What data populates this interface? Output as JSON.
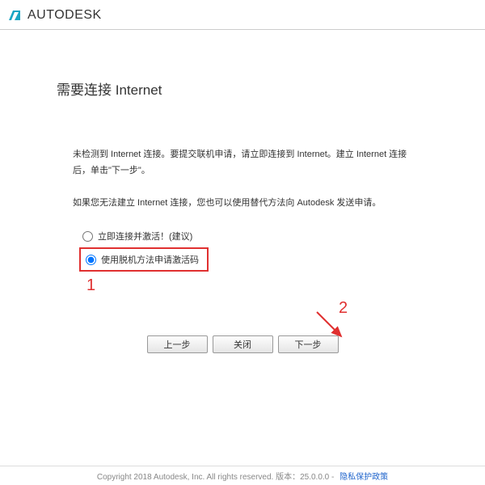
{
  "header": {
    "brand": "AUTODESK"
  },
  "page": {
    "title": "需要连接 Internet"
  },
  "body": {
    "paragraph1": "未检测到 Internet 连接。要提交联机申请，请立即连接到 Internet。建立 Internet 连接后，单击\"下一步\"。",
    "paragraph2": "如果您无法建立 Internet 连接，您也可以使用替代方法向 Autodesk 发送申请。"
  },
  "options": {
    "opt1_label": "立即连接并激活！(建议)",
    "opt2_label": "使用脱机方法申请激活码"
  },
  "annotations": {
    "mark1": "1",
    "mark2": "2"
  },
  "buttons": {
    "back": "上一步",
    "close": "关闭",
    "next": "下一步"
  },
  "footer": {
    "copyright": "Copyright 2018 Autodesk, Inc. All rights reserved.  版本：25.0.0.0 -",
    "privacy": "隐私保护政策"
  }
}
